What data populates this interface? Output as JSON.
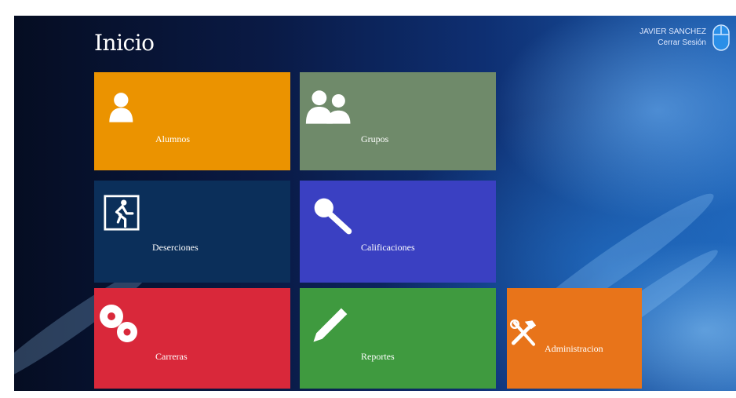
{
  "header": {
    "title": "Inicio",
    "user_name": "JAVIER SANCHEZ",
    "user_role": "Cerrar Sesión"
  },
  "tiles": [
    {
      "label": "Alumnos",
      "icon": "user-icon",
      "color": "#eb9300"
    },
    {
      "label": "Grupos",
      "icon": "users-icon",
      "color": "#6f8a6a"
    },
    {
      "label": "Deserciones",
      "icon": "exit-running-icon",
      "color": "#0b2f5a"
    },
    {
      "label": "Calificaciones",
      "icon": "magnifier-icon",
      "color": "#3a40c2"
    },
    {
      "label": "Carreras",
      "icon": "gears-icon",
      "color": "#d9283a"
    },
    {
      "label": "Reportes",
      "icon": "pencil-icon",
      "color": "#3f9a3f"
    },
    {
      "label": "Administracion",
      "icon": "tools-icon",
      "color": "#e8741a"
    }
  ],
  "accent": "#1d5fb2"
}
